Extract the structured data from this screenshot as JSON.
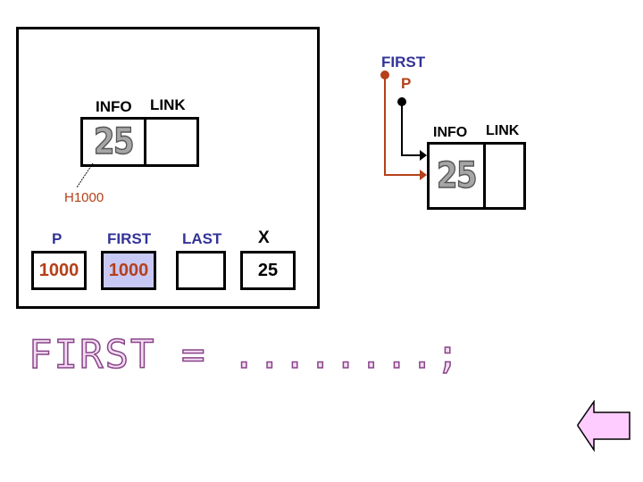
{
  "left_panel": {
    "node": {
      "info_label": "INFO",
      "link_label": "LINK",
      "info_value": "25",
      "link_value": "",
      "address_label": "H1000"
    },
    "variables": [
      {
        "name": "P",
        "value": "1000"
      },
      {
        "name": "FIRST",
        "value": "1000"
      },
      {
        "name": "LAST",
        "value": ""
      },
      {
        "name": "X",
        "value": "25"
      }
    ]
  },
  "right_diagram": {
    "first_pointer_label": "FIRST",
    "p_pointer_label": "P",
    "node": {
      "info_label": "INFO",
      "link_label": "LINK",
      "info_value": "25",
      "link_value": ""
    }
  },
  "formula": {
    "lhs": "FIRST",
    "equals": "=",
    "rhs": "........;"
  },
  "nav": {
    "back_icon": "left-arrow-icon"
  },
  "colors": {
    "pointer_first": "#b5401a",
    "pointer_p": "#000000",
    "label_blue": "#333399",
    "value_red": "#b5401a",
    "first_box_fill": "#c8c8f5",
    "formula_fill": "#f2dcf2",
    "arrow_fill": "#ffccff"
  }
}
